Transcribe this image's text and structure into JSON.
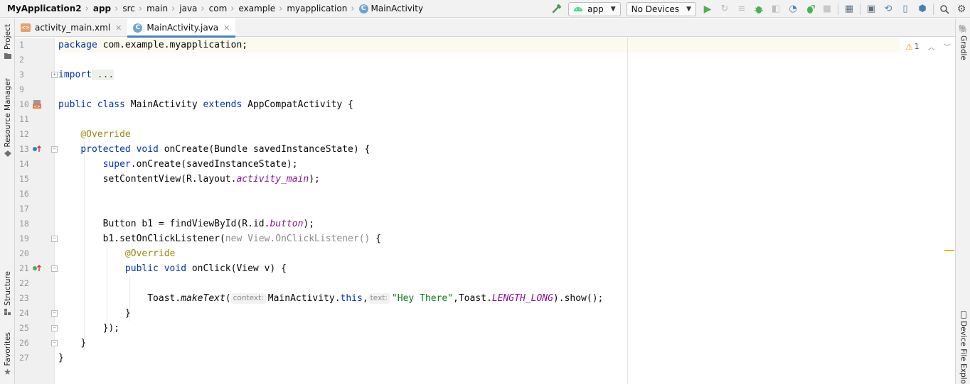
{
  "breadcrumb": [
    "MyApplication2",
    "app",
    "src",
    "main",
    "java",
    "com",
    "example",
    "myapplication",
    "MainActivity"
  ],
  "toolbar": {
    "run_config": "app",
    "device": "No Devices"
  },
  "left_tools": [
    "Project",
    "Resource Manager",
    "Structure",
    "Favorites"
  ],
  "right_tools": [
    "Gradle",
    "Device File Explo"
  ],
  "tabs": [
    {
      "label": "activity_main.xml",
      "active": false
    },
    {
      "label": "MainActivity.java",
      "active": true
    }
  ],
  "inspection": {
    "warnings": "1"
  },
  "gutter": [
    "1",
    "2",
    "3",
    "9",
    "10",
    "11",
    "12",
    "13",
    "14",
    "15",
    "16",
    "17",
    "18",
    "19",
    "20",
    "21",
    "22",
    "23",
    "24",
    "25",
    "26",
    "27"
  ],
  "code": {
    "l1": {
      "kw": "package",
      "rest": " com.example.myapplication;"
    },
    "l3": {
      "kw": "import",
      "fold": " ..."
    },
    "l10": {
      "kw1": "public class",
      "name": " MainActivity ",
      "kw2": "extends",
      "rest": " AppCompatActivity {"
    },
    "l12": {
      "ann": "@Override"
    },
    "l13": {
      "kw": "protected void",
      "rest": " onCreate(Bundle savedInstanceState) {"
    },
    "l14": {
      "kw": "super",
      "rest": ".onCreate(savedInstanceState);"
    },
    "l15": {
      "pre": "setContentView(R.layout.",
      "fld": "activity_main",
      "post": ");"
    },
    "l18": {
      "pre": "Button b1 = findViewById(R.id.",
      "fld": "button",
      "post": ");"
    },
    "l19": {
      "pre": "b1.setOnClickListener(",
      "folded": "new View.OnClickListener()",
      "post": " {"
    },
    "l20": {
      "ann": "@Override"
    },
    "l21": {
      "kw": "public void",
      "rest": " onClick(View v) {"
    },
    "l23": {
      "pre": "Toast.",
      "method": "makeText",
      "open": "(",
      "hint1": "context:",
      "arg1": "MainActivity.",
      "kw": "this",
      "comma": ",",
      "hint2": "text:",
      "str": "\"Hey There\"",
      "mid": ",Toast.",
      "fld": "LENGTH_LONG",
      "post": ").show();"
    },
    "l24": {
      "text": "}"
    },
    "l25": {
      "text": "});"
    },
    "l26": {
      "text": "}"
    },
    "l27": {
      "text": "}"
    }
  }
}
